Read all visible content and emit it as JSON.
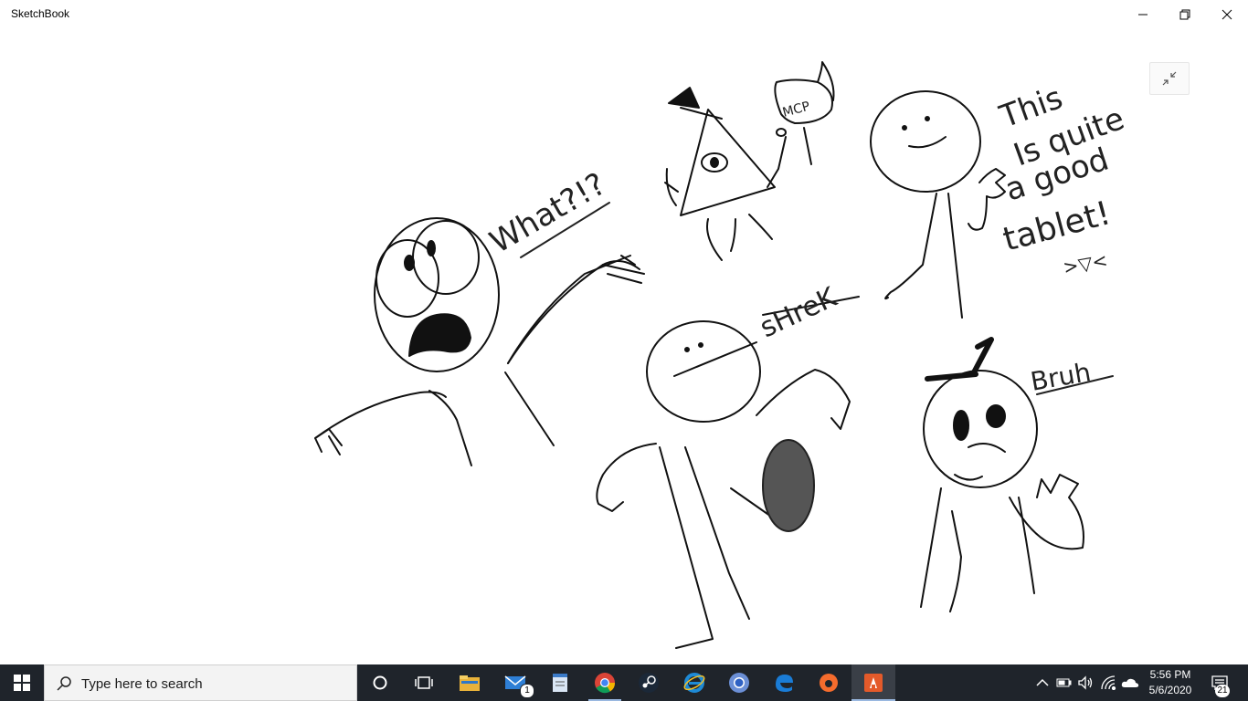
{
  "window": {
    "title": "SketchBook",
    "controls": [
      "minimize-icon",
      "restore-icon",
      "close-icon"
    ]
  },
  "canvas": {
    "exit_fullscreen_icon": "exit-fullscreen-icon",
    "handwriting": {
      "what": "What?!?",
      "mcp": "MCP",
      "shrek": "sHreK",
      "this": "This",
      "is": "Is quite",
      "a_good": "a good",
      "tablet": "tablet!",
      "face": ">▽<",
      "bruh": "Bruh"
    }
  },
  "taskbar": {
    "search_placeholder": "Type here to search",
    "apps": [
      "cortana-icon",
      "task-view-icon",
      "file-explorer-icon",
      "mail-icon",
      "notepad-icon",
      "chrome-icon",
      "steam-icon",
      "internet-explorer-icon",
      "chrome-alt-icon",
      "edge-icon",
      "origin-icon",
      "sketchbook-icon"
    ],
    "mail_badge": "1",
    "clock_time": "5:56 PM",
    "clock_date": "5/6/2020",
    "notification_count": "21",
    "colors": {
      "taskbar": "#1f242b",
      "active_underline": "#9ab8e0"
    }
  }
}
